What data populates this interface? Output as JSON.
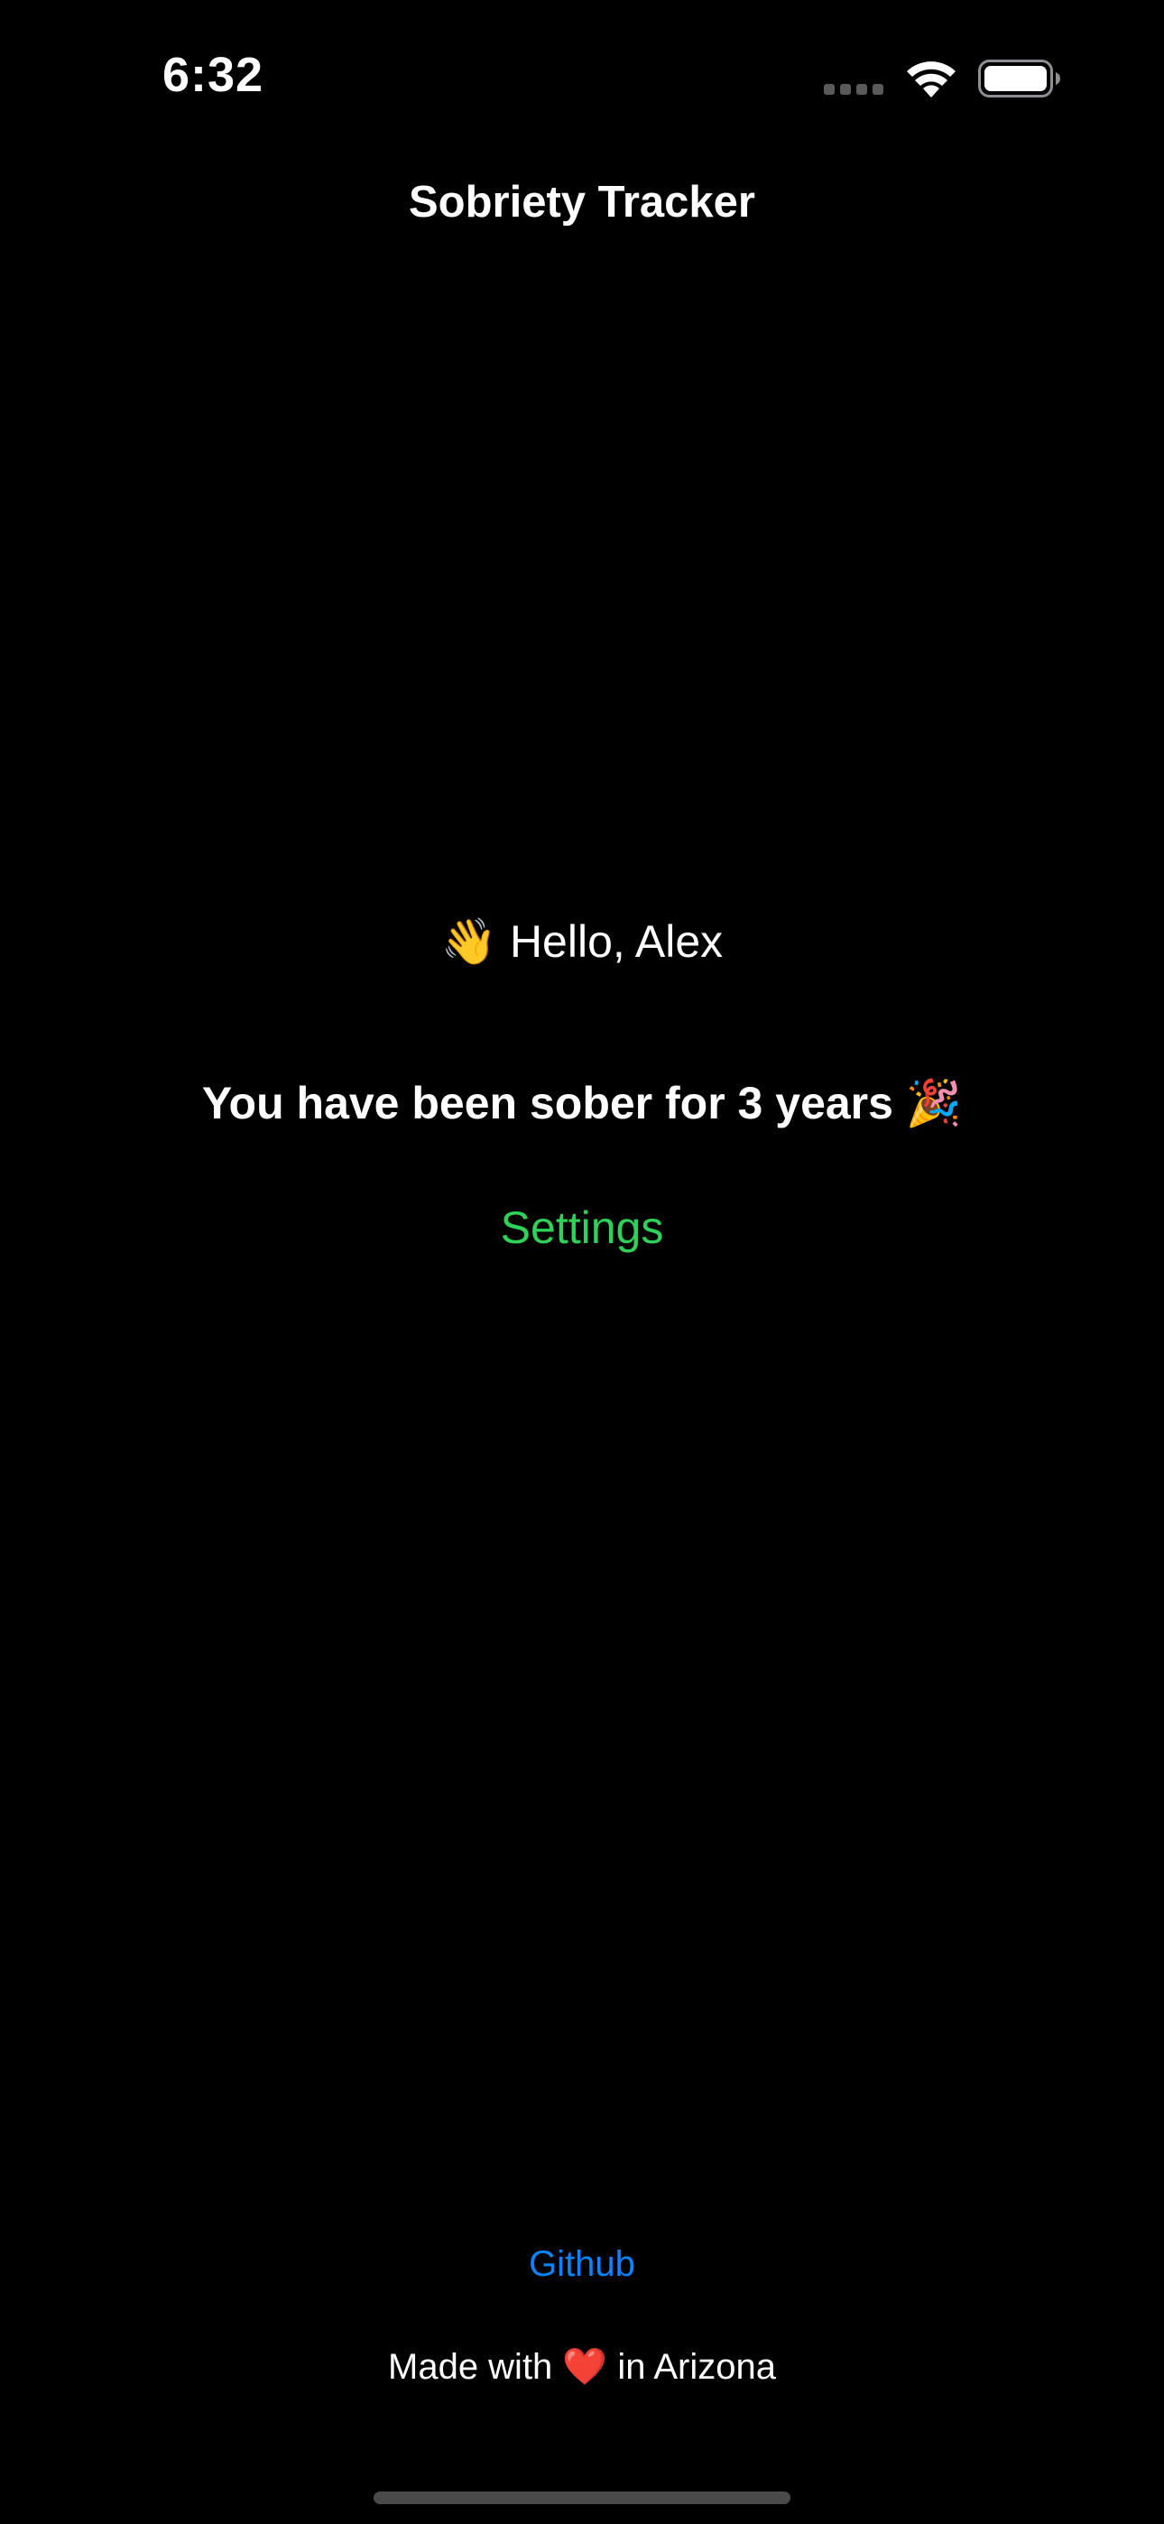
{
  "status_bar": {
    "time": "6:32",
    "icons": [
      "signal-icon",
      "wifi-icon",
      "battery-icon"
    ]
  },
  "nav": {
    "title": "Sobriety Tracker"
  },
  "main": {
    "greeting": "👋 Hello, Alex",
    "sober_message": "You have been sober for 3 years 🎉",
    "settings_label": "Settings"
  },
  "footer": {
    "github_label": "Github",
    "made_with": "Made with ❤️ in Arizona"
  },
  "colors": {
    "background": "#000000",
    "text": "#ffffff",
    "accent_green": "#30d158",
    "link_blue": "#0a84ff"
  }
}
